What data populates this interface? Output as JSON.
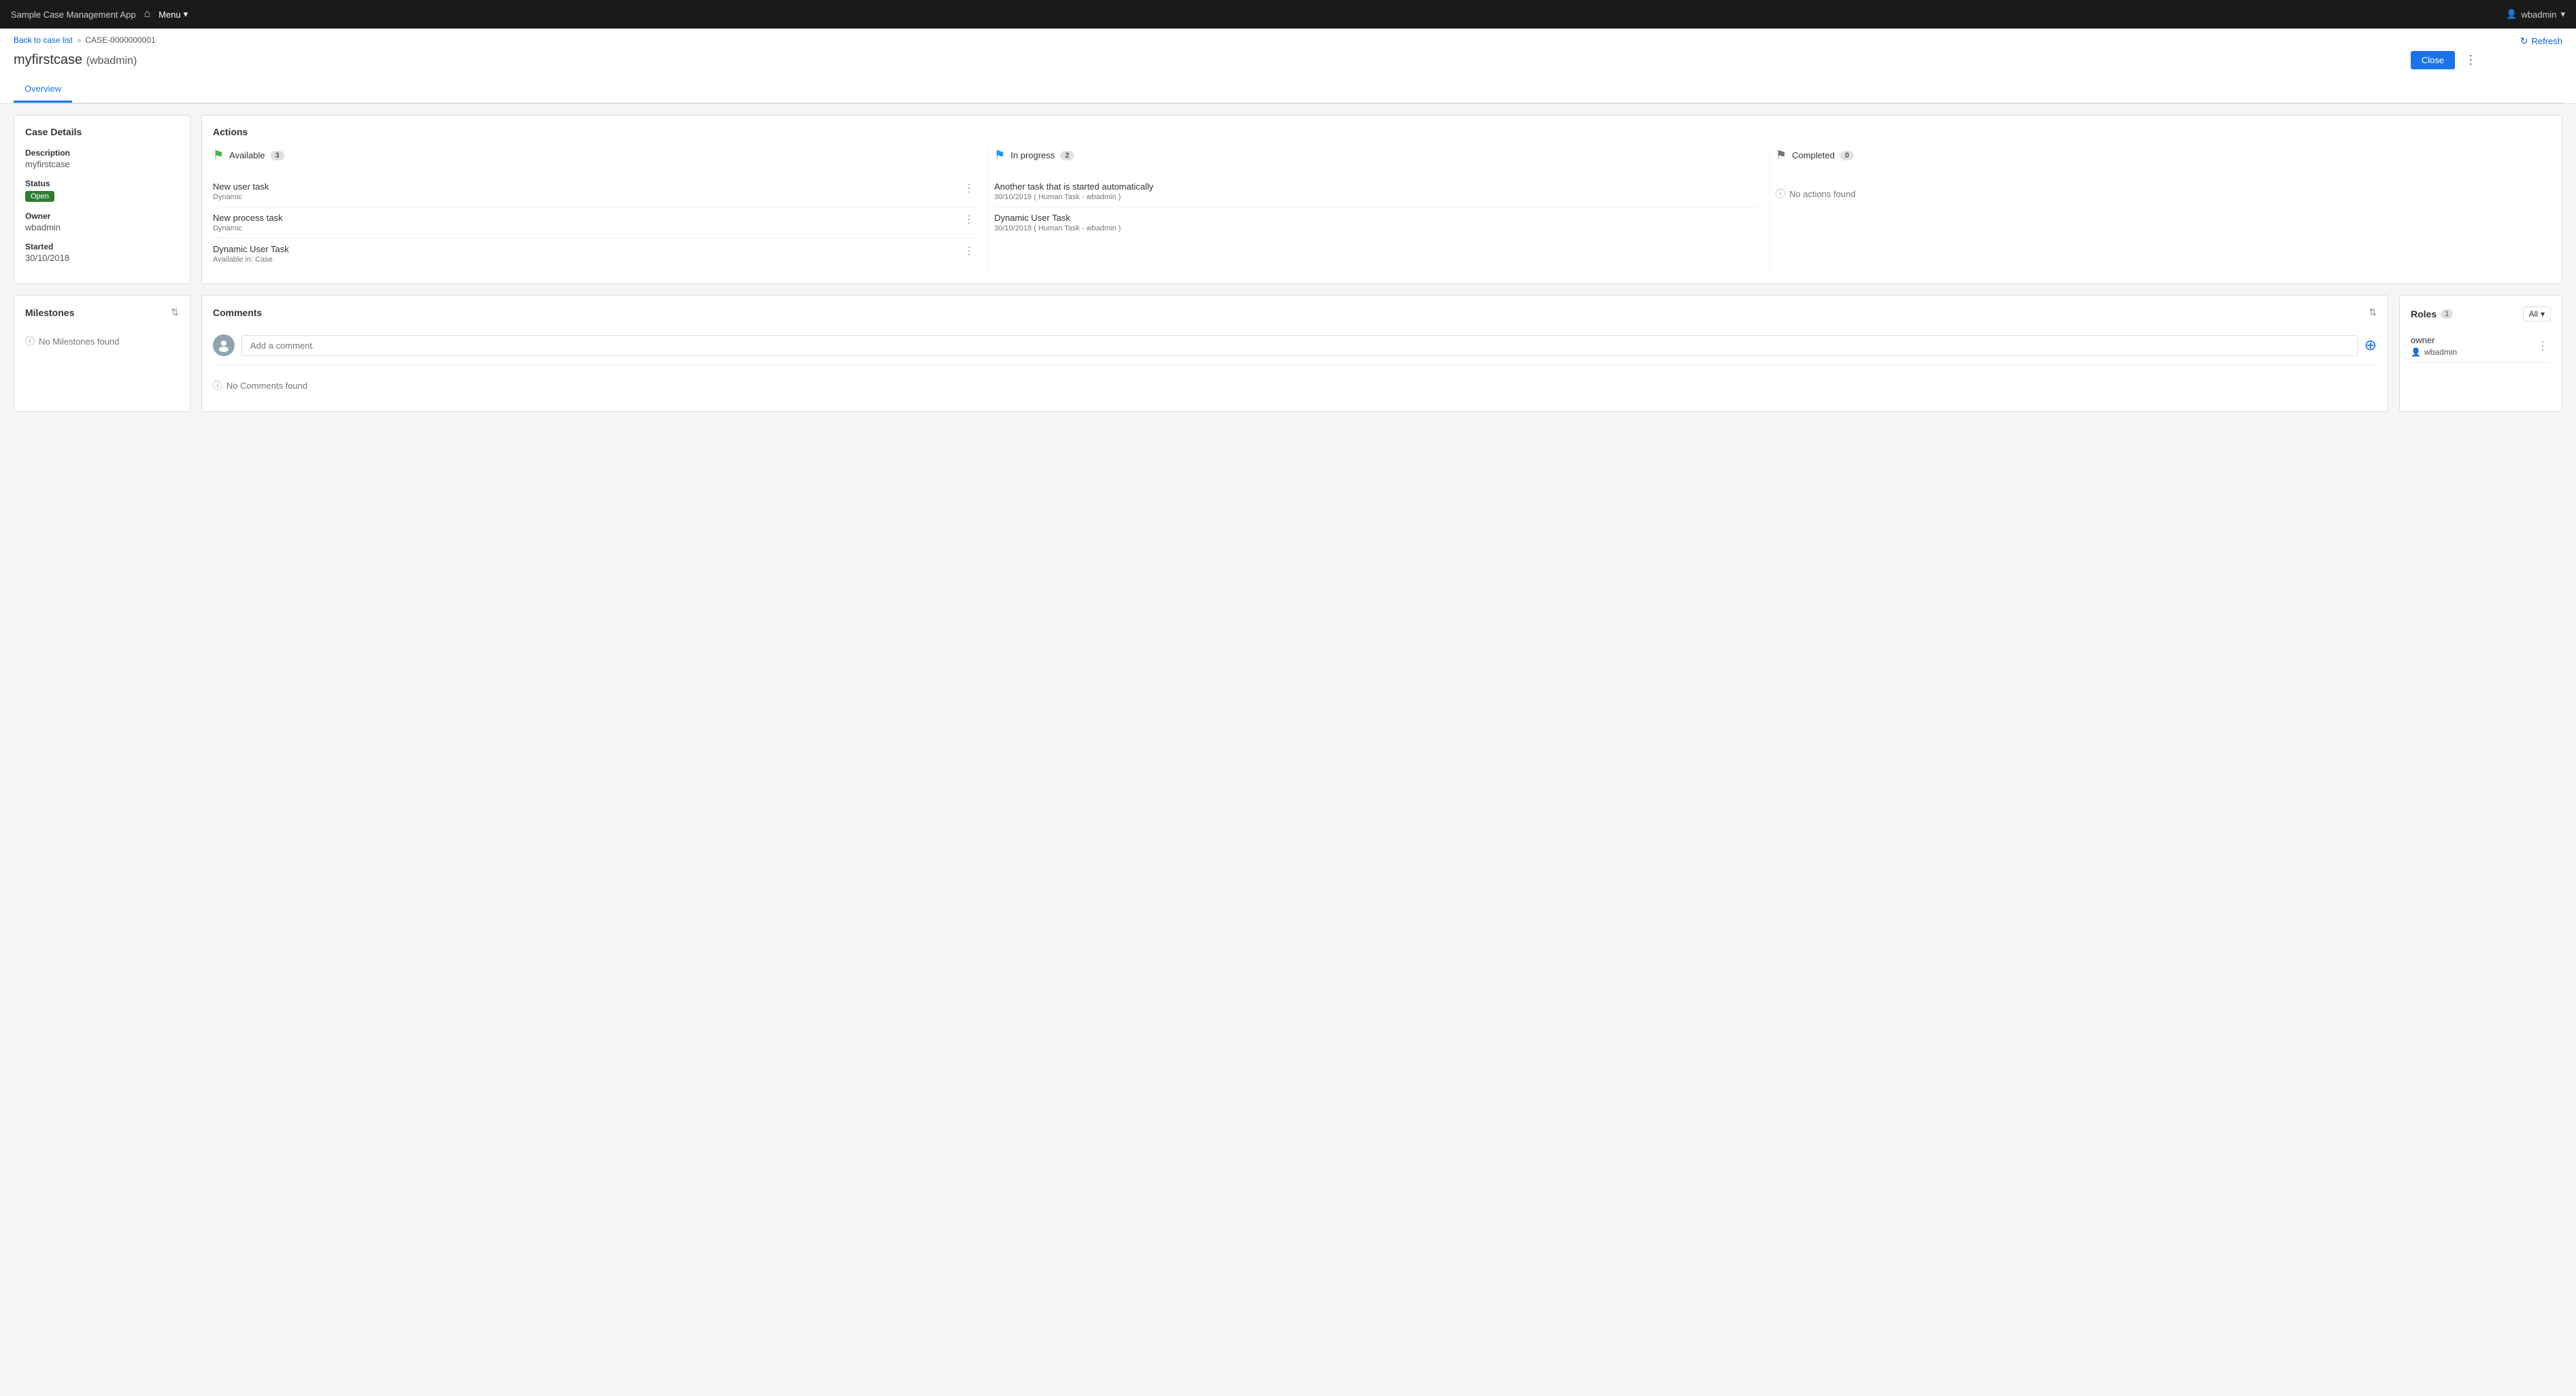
{
  "navbar": {
    "app_title": "Sample Case Management App",
    "menu_label": "Menu",
    "user_label": "wbadmin",
    "home_icon": "⌂",
    "chevron_down": "▾",
    "user_icon": "👤"
  },
  "breadcrumb": {
    "back_link": "Back to case list",
    "separator": "»",
    "current": "CASE-0000000001"
  },
  "page": {
    "title": "myfirstcase",
    "title_user": "(wbadmin)",
    "refresh_label": "Refresh",
    "close_label": "Close",
    "kebab": "⋮"
  },
  "tabs": [
    {
      "label": "Overview",
      "active": true
    }
  ],
  "case_details": {
    "panel_title": "Case Details",
    "description_label": "Description",
    "description_value": "myfirstcase",
    "status_label": "Status",
    "status_value": "Open",
    "owner_label": "Owner",
    "owner_value": "wbadmin",
    "started_label": "Started",
    "started_value": "30/10/2018"
  },
  "actions": {
    "panel_title": "Actions",
    "columns": [
      {
        "id": "available",
        "title": "Available",
        "badge": "3",
        "flag": "⚑",
        "flag_class": "flag-available",
        "items": [
          {
            "name": "New user task",
            "sub": "Dynamic",
            "has_menu": true
          },
          {
            "name": "New process task",
            "sub": "Dynamic",
            "has_menu": true
          },
          {
            "name": "Dynamic User Task",
            "sub": "Available in: Case",
            "has_menu": true
          }
        ],
        "empty": false
      },
      {
        "id": "inprogress",
        "title": "In progress",
        "badge": "2",
        "flag": "⚑",
        "flag_class": "flag-inprogress",
        "items": [
          {
            "name": "Another task that is started automatically",
            "sub": "30/10/2018 ( Human Task - wbadmin )",
            "has_menu": false
          },
          {
            "name": "Dynamic User Task",
            "sub": "30/10/2018 ( Human Task - wbadmin )",
            "has_menu": false
          }
        ],
        "empty": false
      },
      {
        "id": "completed",
        "title": "Completed",
        "badge": "0",
        "flag": "⚑",
        "flag_class": "flag-completed",
        "items": [],
        "empty": true,
        "empty_text": "No actions found"
      }
    ]
  },
  "milestones": {
    "panel_title": "Milestones",
    "empty_text": "No Milestones found",
    "sort_icon": "⇅"
  },
  "comments": {
    "panel_title": "Comments",
    "input_placeholder": "Add a comment.",
    "empty_text": "No Comments found",
    "add_icon": "⊕",
    "sort_icon": "⇅"
  },
  "roles": {
    "panel_title": "Roles",
    "badge": "1",
    "filter_label": "All",
    "filter_chevron": "▾",
    "sort_icon": "⇅",
    "items": [
      {
        "role_name": "owner",
        "user_name": "wbadmin",
        "user_icon": "👤"
      }
    ]
  }
}
